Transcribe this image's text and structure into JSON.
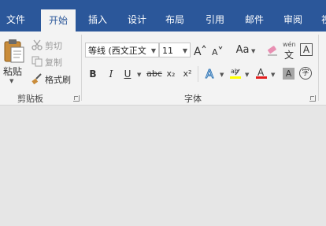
{
  "ribbon_tabs": [
    {
      "label": "文件",
      "active": false
    },
    {
      "label": "开始",
      "active": true
    },
    {
      "label": "插入",
      "active": false
    },
    {
      "label": "设计",
      "active": false
    },
    {
      "label": "布局",
      "active": false
    },
    {
      "label": "引用",
      "active": false
    },
    {
      "label": "邮件",
      "active": false
    },
    {
      "label": "审阅",
      "active": false
    },
    {
      "label": "视图",
      "active": false
    }
  ],
  "clipboard": {
    "paste_label": "粘贴",
    "cut_label": "剪切",
    "copy_label": "复制",
    "format_painter_label": "格式刷",
    "group_label": "剪贴板"
  },
  "font": {
    "font_name": "等线 (西文正文",
    "font_size": "11",
    "bold": "B",
    "italic": "I",
    "underline": "U",
    "strikethrough": "abc",
    "subscript": "x₂",
    "superscript": "x²",
    "change_case": "Aa",
    "phonetic_top": "wén",
    "phonetic_char": "文",
    "char_border": "A",
    "char_shading": "A",
    "enclose_char": "字",
    "group_label": "字体"
  },
  "colors": {
    "ribbon_blue": "#2b579a",
    "highlight_yellow": "#ffff00",
    "font_color_red": "#e21f1f"
  }
}
